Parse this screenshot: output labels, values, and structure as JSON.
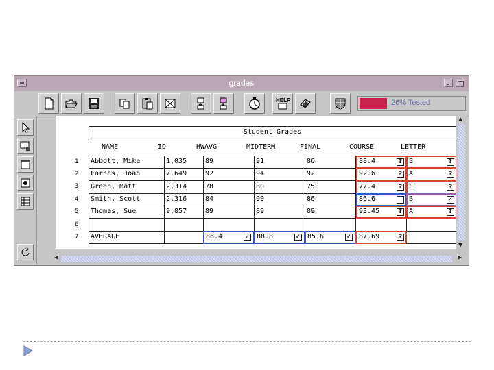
{
  "window": {
    "title": "grades"
  },
  "toolbar": {
    "buttons": [
      "new-icon",
      "open-icon",
      "save-icon",
      "copy-icon",
      "paste-icon",
      "delete-icon",
      "import-icon",
      "export-icon",
      "timer-icon",
      "help-icon",
      "book-icon",
      "shield-icon"
    ],
    "help_label": "HELP!",
    "progress": {
      "percent": 26,
      "label": "26% Tested",
      "fill_color": "#c8234f"
    }
  },
  "left_tools": [
    "arrow-icon",
    "cell-icon",
    "box-icon",
    "radio-icon",
    "table-icon",
    "rotate-icon"
  ],
  "sheet": {
    "title": "Student Grades",
    "columns": [
      "NAME",
      "ID",
      "HWAVG",
      "MIDTERM",
      "FINAL",
      "COURSE",
      "LETTER"
    ],
    "row_numbers": [
      "1",
      "2",
      "3",
      "4",
      "5",
      "6",
      "7"
    ],
    "rows": [
      {
        "name": "Abbott, Mike",
        "id": "1,035",
        "hwavg": "89",
        "midterm": "91",
        "final": "86",
        "course": "88.4",
        "course_mark": "?",
        "letter": "B",
        "letter_mark": "?"
      },
      {
        "name": "Farnes, Joan",
        "id": "7,649",
        "hwavg": "92",
        "midterm": "94",
        "final": "92",
        "course": "92.6",
        "course_mark": "?",
        "letter": "A",
        "letter_mark": "?"
      },
      {
        "name": "Green, Matt",
        "id": "2,314",
        "hwavg": "78",
        "midterm": "80",
        "final": "75",
        "course": "77.4",
        "course_mark": "?",
        "letter": "C",
        "letter_mark": "?"
      },
      {
        "name": "Smith, Scott",
        "id": "2,316",
        "hwavg": "84",
        "midterm": "90",
        "final": "86",
        "course": "86.6",
        "course_mark": "",
        "letter": "B",
        "letter_mark": "✓"
      },
      {
        "name": "Thomas, Sue",
        "id": "9,857",
        "hwavg": "89",
        "midterm": "89",
        "final": "89",
        "course": "93.45",
        "course_mark": "?",
        "letter": "A",
        "letter_mark": "?"
      }
    ],
    "average": {
      "label": "AVERAGE",
      "hwavg": "86.4",
      "hwavg_mark": "✓",
      "midterm": "88.8",
      "midterm_mark": "✓",
      "final": "85.6",
      "final_mark": "✓",
      "course": "87.69",
      "course_mark": "?"
    }
  },
  "colors": {
    "red_border": "#d7432c",
    "blue_border": "#3a55c0",
    "purple_border": "#9a5fa0",
    "title_bar": "#b8a8b3"
  }
}
